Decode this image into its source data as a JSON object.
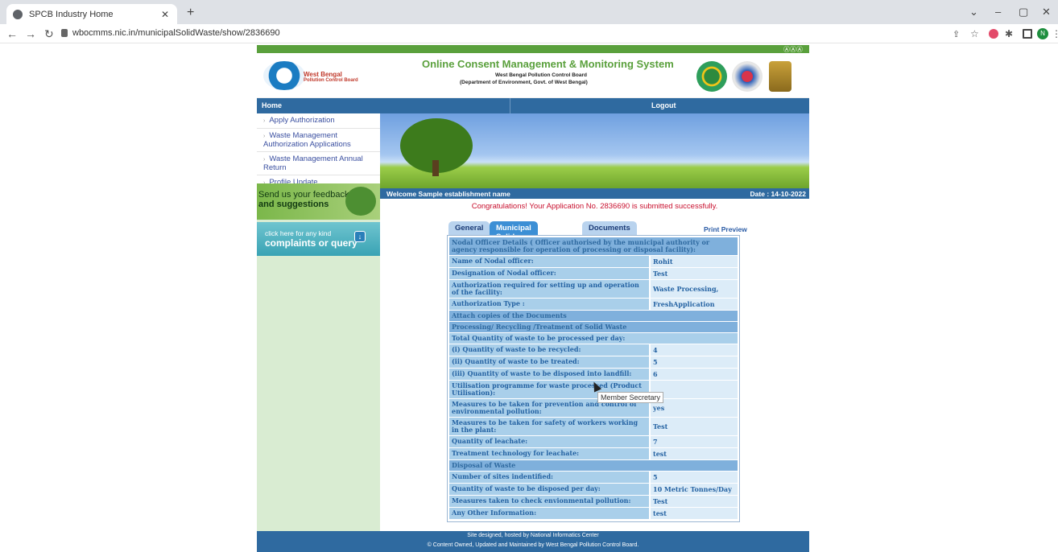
{
  "browser": {
    "tab_title": "SPCB Industry Home",
    "url": "wbocmms.nic.in/municipalSolidWaste/show/2836690"
  },
  "header": {
    "org_name": "West Bengal",
    "org_sub": "Pollution Control Board",
    "system_title": "Online Consent Management & Monitoring System",
    "sub1": "West Bengal Pollution Control Board",
    "sub2": "(Department of Environment, Govt. of West Bengal)",
    "font_icons": "ⒶⒶⒶ"
  },
  "menubar": {
    "home": "Home",
    "logout": "Logout"
  },
  "sidebar": {
    "items": [
      {
        "label": "Apply Authorization"
      },
      {
        "label": "Waste Management Authorization Applications"
      },
      {
        "label": "Waste Management Annual Return"
      },
      {
        "label": "Profile Update"
      }
    ],
    "feedback_1": "Send us your feedback",
    "feedback_2": "and suggestions",
    "complaint_1": "click here for any kind",
    "complaint_2": "complaints or query"
  },
  "welcome": {
    "text": "Welcome Sample establishment name",
    "date": "Date : 14-10-2022"
  },
  "message": "Congratulations! Your Application No. 2836690 is submitted successfully.",
  "tabs": [
    "General",
    "Municipal Solid Waste",
    "Documents"
  ],
  "print_preview": "Print Preview",
  "rows": [
    {
      "type": "sec",
      "label": "Nodal Officer Details ( Officer authorised by the municipal authority or agency responsible for operation of processing or disposal facility):"
    },
    {
      "label": "Name of Nodal officer:",
      "value": "Rohit"
    },
    {
      "label": "Designation of Nodal officer:",
      "value": "Test"
    },
    {
      "label": "Authorization required for setting up and operation of the facility:",
      "value": "Waste Processing,"
    },
    {
      "label": "Authorization Type :",
      "value": "FreshApplication"
    },
    {
      "type": "sec",
      "label": "Attach copies of the Documents"
    },
    {
      "type": "sec",
      "label": "Processing/ Recycling /Treatment of Solid Waste"
    },
    {
      "type": "full",
      "label": "Total Quantity of waste to be processed per day:"
    },
    {
      "label": "(i) Quantity of waste to be recycled:",
      "value": "4"
    },
    {
      "label": "(ii) Quantity of waste to be treated:",
      "value": "5"
    },
    {
      "label": "(iii) Quantity of waste to be disposed into landfill:",
      "value": "6"
    },
    {
      "label": "Utilisation programme for waste processed (Product Utilisation):",
      "value": ""
    },
    {
      "label": "Measures to be taken for prevention and control of environmental pollution:",
      "value": "yes"
    },
    {
      "label": "Measures to be taken for safety of workers working in the plant:",
      "value": "Test"
    },
    {
      "label": "Quantity of leachate:",
      "value": "7"
    },
    {
      "label": "Treatment technology for leachate:",
      "value": "test"
    },
    {
      "type": "sec",
      "label": "Disposal of Waste"
    },
    {
      "label": "Number of sites indentified:",
      "value": "5"
    },
    {
      "label": "Quantity of waste to be disposed per day:",
      "value": "10 Metric Tonnes/Day"
    },
    {
      "label": "Measures taken to check envionmental pollution:",
      "value": "Test"
    },
    {
      "label": "Any Other Information:",
      "value": "test"
    }
  ],
  "tooltip": "Member Secretary",
  "footer": {
    "line1": "Site designed, hosted by National Informatics Center",
    "line2": "© Content Owned, Updated and Maintained by West Bengal Pollution Control Board."
  }
}
